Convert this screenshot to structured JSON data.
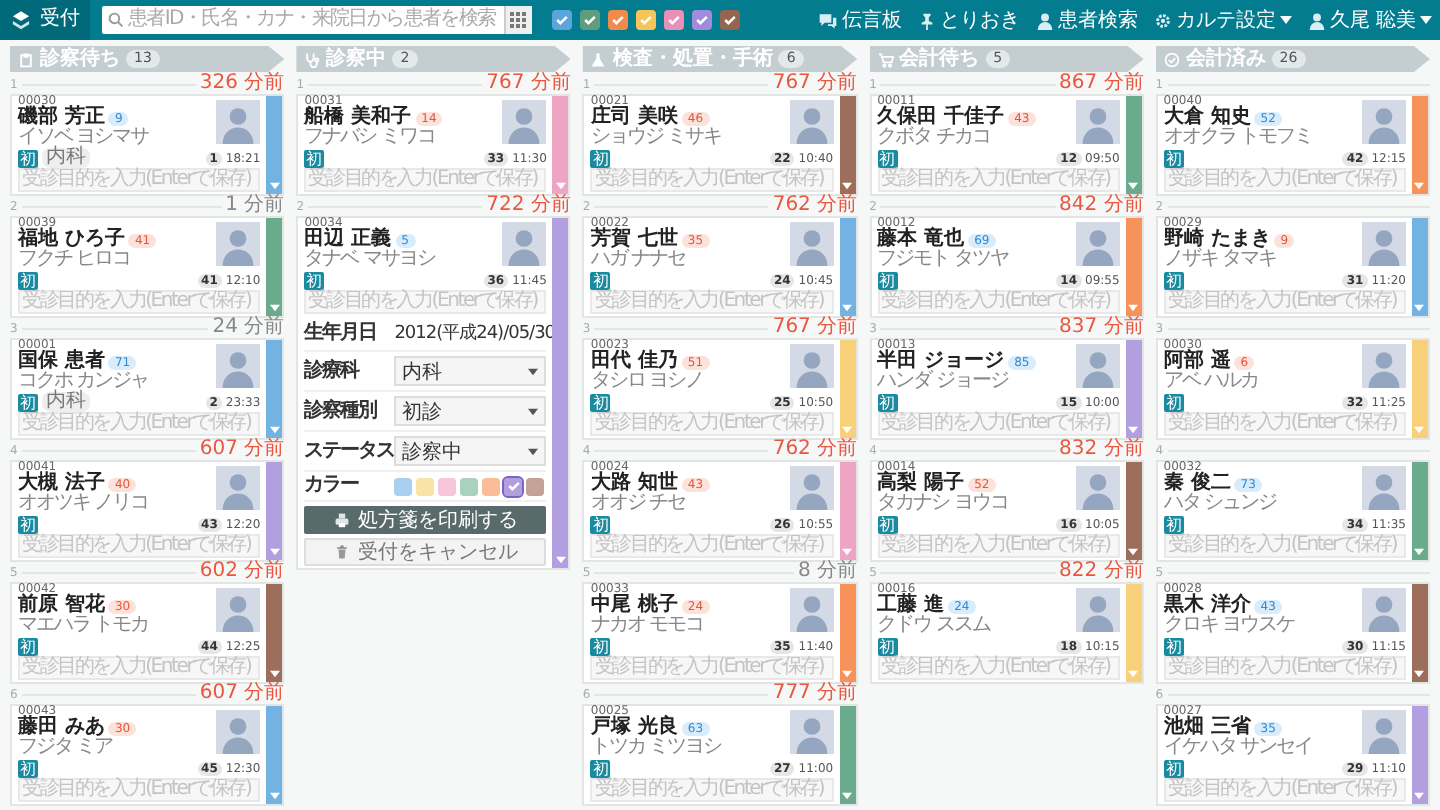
{
  "header": {
    "reception": "受付",
    "search_placeholder": "患者ID・氏名・カナ・来院日から患者を検索",
    "filters": [
      {
        "color": "#5aa5dc",
        "checked": true
      },
      {
        "color": "#5e9e7c",
        "checked": true
      },
      {
        "color": "#f28a4b",
        "checked": true
      },
      {
        "color": "#f5c55a",
        "checked": true
      },
      {
        "color": "#ea8fb5",
        "checked": true
      },
      {
        "color": "#a08bdc",
        "checked": true
      },
      {
        "color": "#96654f",
        "checked": true
      }
    ],
    "nav": [
      {
        "kind": "chat",
        "label": "伝言板",
        "menu": false
      },
      {
        "kind": "pin",
        "label": "とりおき",
        "menu": false
      },
      {
        "kind": "person",
        "label": "患者検索",
        "menu": false
      },
      {
        "kind": "gear",
        "label": "カルテ設定",
        "menu": true
      },
      {
        "kind": "person",
        "label": "久尾 聡美",
        "menu": true
      }
    ]
  },
  "columns": [
    {
      "kind": "clipboard",
      "title": "診察待ち",
      "count": "13",
      "cards": [
        {
          "index": "1",
          "elapsed": "326 分前",
          "overdue": true,
          "id": "00030",
          "name": "磯部 芳正",
          "age": "9",
          "female": false,
          "kana": "イソベ ヨシマサ",
          "tag": "初",
          "dept": "内科",
          "number": "1",
          "time": "18:21",
          "placeholder": "受診目的を入力(Enterで保存)",
          "color": "#72b3e3"
        },
        {
          "index": "2",
          "elapsed": "1 分前",
          "overdue": false,
          "id": "00039",
          "name": "福地 ひろ子",
          "age": "41",
          "female": true,
          "kana": "フクチ ヒロコ",
          "tag": "初",
          "number": "41",
          "time": "12:10",
          "placeholder": "受診目的を入力(Enterで保存)",
          "color": "#6aab8e"
        },
        {
          "index": "3",
          "elapsed": "24 分前",
          "overdue": false,
          "id": "00001",
          "name": "国保 患者",
          "age": "71",
          "female": false,
          "kana": "コクホ カンジャ",
          "tag": "初",
          "dept": "内科",
          "number": "2",
          "time": "23:33",
          "placeholder": "受診目的を入力(Enterで保存)",
          "color": "#72b3e3"
        },
        {
          "index": "4",
          "elapsed": "607 分前",
          "overdue": true,
          "id": "00041",
          "name": "大槻 法子",
          "age": "40",
          "female": true,
          "kana": "オオツキ ノリコ",
          "tag": "初",
          "number": "43",
          "time": "12:20",
          "placeholder": "受診目的を入力(Enterで保存)",
          "color": "#b29fe0"
        },
        {
          "index": "5",
          "elapsed": "602 分前",
          "overdue": true,
          "id": "00042",
          "name": "前原 智花",
          "age": "30",
          "female": true,
          "kana": "マエハラ トモカ",
          "tag": "初",
          "number": "44",
          "time": "12:25",
          "placeholder": "受診目的を入力(Enterで保存)",
          "color": "#9e6e5c"
        },
        {
          "index": "6",
          "elapsed": "607 分前",
          "overdue": true,
          "id": "00043",
          "name": "藤田 みあ",
          "age": "30",
          "female": true,
          "kana": "フジタ ミア",
          "tag": "初",
          "number": "45",
          "time": "12:30",
          "placeholder": "受診目的を入力(Enterで保存)",
          "color": "#72b3e3"
        }
      ]
    },
    {
      "kind": "stethoscope",
      "title": "診察中",
      "count": "2",
      "cards": [
        {
          "index": "1",
          "elapsed": "767 分前",
          "overdue": true,
          "id": "00031",
          "name": "船橋 美和子",
          "age": "14",
          "female": true,
          "kana": "フナバシ ミワコ",
          "tag": "初",
          "number": "33",
          "time": "11:30",
          "placeholder": "受診目的を入力(Enterで保存)",
          "color": "#eea4c2"
        },
        {
          "index": "2",
          "elapsed": "722 分前",
          "overdue": true,
          "id": "00034",
          "name": "田辺 正義",
          "age": "5",
          "female": false,
          "kana": "タナベ マサヨシ",
          "tag": "初",
          "number": "36",
          "time": "11:45",
          "placeholder": "受診目的を入力(Enterで保存)",
          "color": "#b29fe0",
          "details": {
            "birth_label": "生年月日",
            "birth": "2012(平成24)/05/30",
            "fields": [
              {
                "label": "診療科",
                "value": "内科"
              },
              {
                "label": "診察種別",
                "value": "初診"
              },
              {
                "label": "ステータス",
                "value": "診察中"
              }
            ],
            "color_label": "カラー",
            "swatches": [
              {
                "color": "#a9d0f0",
                "selected": false
              },
              {
                "color": "#fbe3a6",
                "selected": false
              },
              {
                "color": "#f6c6d9",
                "selected": false
              },
              {
                "color": "#a9d2be",
                "selected": false
              },
              {
                "color": "#fbbd98",
                "selected": false
              },
              {
                "color": "#b29fe0",
                "selected": true
              },
              {
                "color": "#c4a295",
                "selected": false
              }
            ],
            "print_button": "処方箋を印刷する",
            "cancel_button": "受付をキャンセル"
          }
        }
      ]
    },
    {
      "kind": "flask",
      "title": "検査・処置・手術",
      "count": "6",
      "cards": [
        {
          "index": "1",
          "elapsed": "767 分前",
          "overdue": true,
          "id": "00021",
          "name": "庄司 美咲",
          "age": "46",
          "female": true,
          "kana": "ショウジ ミサキ",
          "tag": "初",
          "number": "22",
          "time": "10:40",
          "placeholder": "受診目的を入力(Enterで保存)",
          "color": "#9e6e5c"
        },
        {
          "index": "2",
          "elapsed": "762 分前",
          "overdue": true,
          "id": "00022",
          "name": "芳賀 七世",
          "age": "35",
          "female": true,
          "kana": "ハガ ナナセ",
          "tag": "初",
          "number": "24",
          "time": "10:45",
          "placeholder": "受診目的を入力(Enterで保存)",
          "color": "#72b3e3"
        },
        {
          "index": "3",
          "elapsed": "767 分前",
          "overdue": true,
          "id": "00023",
          "name": "田代 佳乃",
          "age": "51",
          "female": true,
          "kana": "タシロ ヨシノ",
          "tag": "初",
          "number": "25",
          "time": "10:50",
          "placeholder": "受診目的を入力(Enterで保存)",
          "color": "#f9d07a"
        },
        {
          "index": "4",
          "elapsed": "762 分前",
          "overdue": true,
          "id": "00024",
          "name": "大路 知世",
          "age": "43",
          "female": true,
          "kana": "オオジ チセ",
          "tag": "初",
          "number": "26",
          "time": "10:55",
          "placeholder": "受診目的を入力(Enterで保存)",
          "color": "#eea4c2"
        },
        {
          "index": "5",
          "elapsed": "8 分前",
          "overdue": false,
          "id": "00033",
          "name": "中尾 桃子",
          "age": "24",
          "female": true,
          "kana": "ナカオ モモコ",
          "tag": "初",
          "number": "35",
          "time": "11:40",
          "placeholder": "受診目的を入力(Enterで保存)",
          "color": "#f7925a"
        },
        {
          "index": "6",
          "elapsed": "777 分前",
          "overdue": true,
          "id": "00025",
          "name": "戸塚 光良",
          "age": "63",
          "female": false,
          "kana": "トツカ ミツヨシ",
          "tag": "初",
          "number": "27",
          "time": "11:00",
          "placeholder": "受診目的を入力(Enterで保存)",
          "color": "#6aab8e"
        }
      ]
    },
    {
      "kind": "cart",
      "title": "会計待ち",
      "count": "5",
      "cards": [
        {
          "index": "1",
          "elapsed": "867 分前",
          "overdue": true,
          "id": "00011",
          "name": "久保田 千佳子",
          "age": "43",
          "female": true,
          "kana": "クボタ チカコ",
          "tag": "初",
          "number": "12",
          "time": "09:50",
          "placeholder": "受診目的を入力(Enterで保存)",
          "color": "#6aab8e"
        },
        {
          "index": "2",
          "elapsed": "842 分前",
          "overdue": true,
          "id": "00012",
          "name": "藤本 竜也",
          "age": "69",
          "female": false,
          "kana": "フジモト タツヤ",
          "tag": "初",
          "number": "14",
          "time": "09:55",
          "placeholder": "受診目的を入力(Enterで保存)",
          "color": "#f7925a"
        },
        {
          "index": "3",
          "elapsed": "837 分前",
          "overdue": true,
          "id": "00013",
          "name": "半田 ジョージ",
          "age": "85",
          "female": false,
          "kana": "ハンダ ジョージ",
          "tag": "初",
          "number": "15",
          "time": "10:00",
          "placeholder": "受診目的を入力(Enterで保存)",
          "color": "#b29fe0"
        },
        {
          "index": "4",
          "elapsed": "832 分前",
          "overdue": true,
          "id": "00014",
          "name": "高梨 陽子",
          "age": "52",
          "female": true,
          "kana": "タカナシ ヨウコ",
          "tag": "初",
          "number": "16",
          "time": "10:05",
          "placeholder": "受診目的を入力(Enterで保存)",
          "color": "#9e6e5c"
        },
        {
          "index": "5",
          "elapsed": "822 分前",
          "overdue": true,
          "id": "00016",
          "name": "工藤 進",
          "age": "24",
          "female": false,
          "kana": "クドウ ススム",
          "tag": "初",
          "number": "18",
          "time": "10:15",
          "placeholder": "受診目的を入力(Enterで保存)",
          "color": "#f9d07a"
        }
      ]
    },
    {
      "kind": "check",
      "title": "会計済み",
      "count": "26",
      "cards": [
        {
          "index": "1",
          "id": "00040",
          "name": "大倉 知史",
          "age": "52",
          "female": false,
          "kana": "オオクラ トモフミ",
          "tag": "初",
          "number": "42",
          "time": "12:15",
          "placeholder": "受診目的を入力(Enterで保存)",
          "color": "#f7925a"
        },
        {
          "index": "2",
          "id": "00029",
          "name": "野崎 たまき",
          "age": "9",
          "female": true,
          "kana": "ノザキ タマキ",
          "tag": "初",
          "number": "31",
          "time": "11:20",
          "placeholder": "受診目的を入力(Enterで保存)",
          "color": "#72b3e3"
        },
        {
          "index": "3",
          "id": "00030",
          "name": "阿部 遥",
          "age": "6",
          "female": true,
          "kana": "アベ ハルカ",
          "tag": "初",
          "number": "32",
          "time": "11:25",
          "placeholder": "受診目的を入力(Enterで保存)",
          "color": "#f9d07a"
        },
        {
          "index": "4",
          "id": "00032",
          "name": "秦 俊二",
          "age": "73",
          "female": false,
          "kana": "ハタ シュンジ",
          "tag": "初",
          "number": "34",
          "time": "11:35",
          "placeholder": "受診目的を入力(Enterで保存)",
          "color": "#6aab8e"
        },
        {
          "index": "5",
          "id": "00028",
          "name": "黒木 洋介",
          "age": "43",
          "female": false,
          "kana": "クロキ ヨウスケ",
          "tag": "初",
          "number": "30",
          "time": "11:15",
          "placeholder": "受診目的を入力(Enterで保存)",
          "color": "#9e6e5c"
        },
        {
          "index": "6",
          "id": "00027",
          "name": "池畑 三省",
          "age": "35",
          "female": false,
          "kana": "イケハタ サンセイ",
          "tag": "初",
          "number": "29",
          "time": "11:10",
          "placeholder": "受診目的を入力(Enterで保存)",
          "color": "#b29fe0"
        }
      ]
    }
  ]
}
